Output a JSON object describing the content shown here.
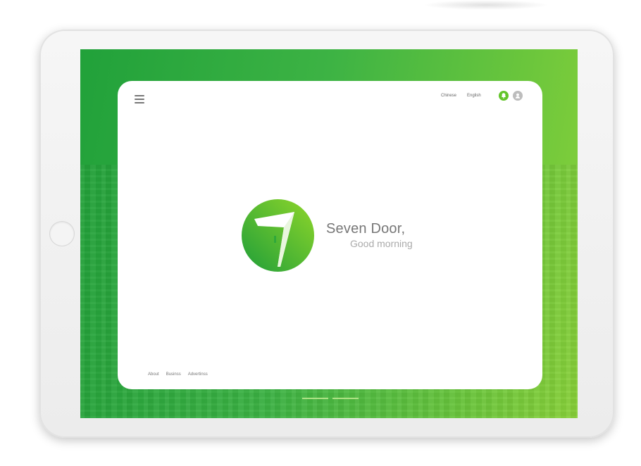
{
  "top_bar": {
    "languages": [
      {
        "label": "Chinese"
      },
      {
        "label": "English",
        "active": true
      }
    ],
    "icons": [
      "menu-icon",
      "bell-icon",
      "user-icon"
    ]
  },
  "hero": {
    "brand_greeting": "Seven Door,",
    "greeting": "Good morning",
    "logo_icon": "seven-door-logo"
  },
  "footer": {
    "links": [
      "About",
      "Businss",
      "Advertinss"
    ]
  },
  "carousel": {
    "indicator_count": 2
  },
  "colors": {
    "accent_green": "#63c52b",
    "gradient_start": "#21a13a",
    "gradient_end": "#89d13a",
    "text_gray": "#777777"
  }
}
